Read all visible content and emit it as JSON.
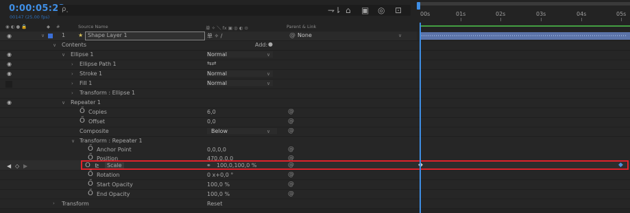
{
  "composition": {
    "timecode": "0:00:05:22",
    "frames": "00147 (25.00 fps)"
  },
  "search": {
    "glyph": "ρ˯"
  },
  "ruler": {
    "ticks": [
      "00s",
      "01s",
      "02s",
      "03s",
      "04s",
      "05s"
    ]
  },
  "columns": {
    "source_name": "Source Name",
    "parent_link": "Parent & Link",
    "switch_icons": "单 ✧ ＼ fx ▣ ◎ ◐ ⊙"
  },
  "layer": {
    "number": "1",
    "name": "Shape Layer 1",
    "switches": "单 ✧ /",
    "parent": "None"
  },
  "contents": {
    "label": "Contents",
    "add_label": "Add:"
  },
  "ellipse": {
    "label": "Ellipse 1",
    "blend": "Normal",
    "path": "Ellipse Path 1",
    "stroke": "Stroke 1",
    "stroke_blend": "Normal",
    "fill": "Fill 1",
    "fill_blend": "Normal",
    "transform": "Transform : Ellipse 1"
  },
  "repeater": {
    "label": "Repeater 1",
    "copies_label": "Copies",
    "copies": "6,0",
    "offset_label": "Offset",
    "offset": "0,0",
    "composite_label": "Composite",
    "composite": "Below",
    "transform_label": "Transform : Repeater 1",
    "anchor_label": "Anchor Point",
    "anchor": "0,0,0,0",
    "position_label": "Position",
    "position": "470,0,0,0",
    "scale_label": "Scale",
    "scale": "100,0,100,0 %",
    "rotation_label": "Rotation",
    "rotation": "0 x+0,0 °",
    "start_opacity_label": "Start Opacity",
    "start_opacity": "100,0 %",
    "end_opacity_label": "End Opacity",
    "end_opacity": "100,0 %"
  },
  "transform": {
    "label": "Transform",
    "reset": "Reset"
  },
  "colors": {
    "accent_blue": "#3f8fe6",
    "highlight_red": "#e0232b",
    "layer_bar": "#5b73a8",
    "work_area_green": "#44a043"
  }
}
